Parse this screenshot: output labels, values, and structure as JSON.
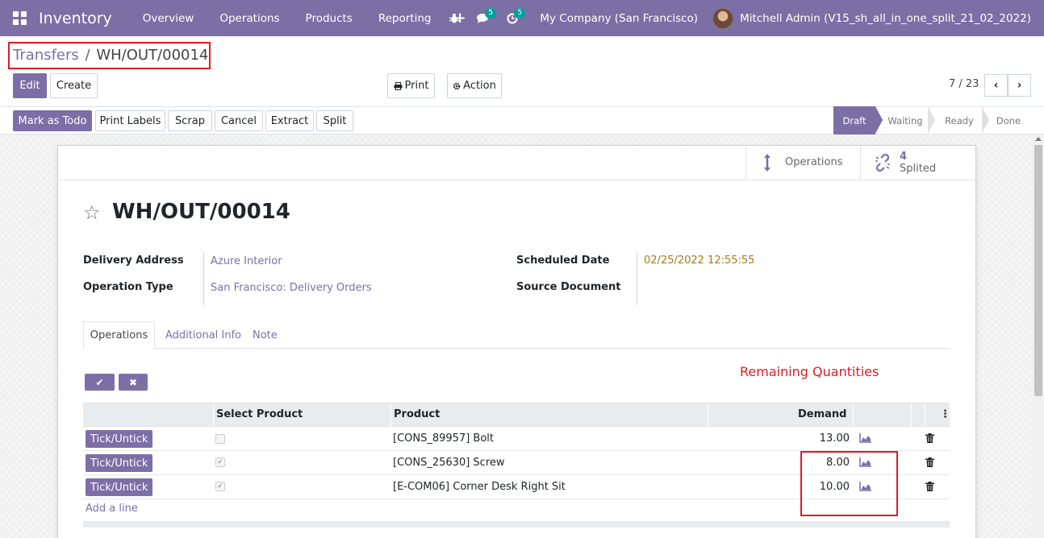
{
  "navbar": {
    "app_name": "Inventory",
    "menu": [
      "Overview",
      "Operations",
      "Products",
      "Reporting"
    ],
    "plus": "+",
    "messages_count": "5",
    "activities_count": "5",
    "company": "My Company (San Francisco)",
    "user": "Mitchell Admin (V15_sh_all_in_one_split_21_02_2022)"
  },
  "breadcrumb": {
    "parent": "Transfers",
    "separator": "/",
    "current": "WH/OUT/00014"
  },
  "control": {
    "edit": "Edit",
    "create": "Create",
    "print": "Print",
    "action": "Action",
    "pager": "7 / 23"
  },
  "statusbar": {
    "buttons": [
      "Mark as Todo",
      "Print Labels",
      "Scrap",
      "Cancel",
      "Extract",
      "Split"
    ],
    "stages": [
      "Draft",
      "Waiting",
      "Ready",
      "Done"
    ],
    "active_stage": "Draft"
  },
  "smart_buttons": {
    "operations": "Operations",
    "splited_count": "4",
    "splited_label": "Splited"
  },
  "record": {
    "title": "WH/OUT/00014",
    "fields": {
      "delivery_address_label": "Delivery Address",
      "delivery_address_value": "Azure Interior",
      "operation_type_label": "Operation Type",
      "operation_type_value": "San Francisco: Delivery Orders",
      "scheduled_date_label": "Scheduled Date",
      "scheduled_date_value": "02/25/2022 12:55:55",
      "source_document_label": "Source Document"
    }
  },
  "tabs": [
    "Operations",
    "Additional Info",
    "Note"
  ],
  "annotation": "Remaining Quantities",
  "table": {
    "headers": [
      "Select Product",
      "Product",
      "Demand"
    ],
    "tick_label": "Tick/Untick",
    "rows": [
      {
        "selected": false,
        "product": "[CONS_89957] Bolt",
        "demand": "13.00"
      },
      {
        "selected": true,
        "product": "[CONS_25630] Screw",
        "demand": "8.00"
      },
      {
        "selected": true,
        "product": "[E-COM06] Corner Desk Right Sit",
        "demand": "10.00"
      }
    ],
    "add_line": "Add a line"
  },
  "colors": {
    "brand": "#7c6fa6",
    "annotation_red": "#e01b24",
    "date_color": "#a07c20"
  }
}
